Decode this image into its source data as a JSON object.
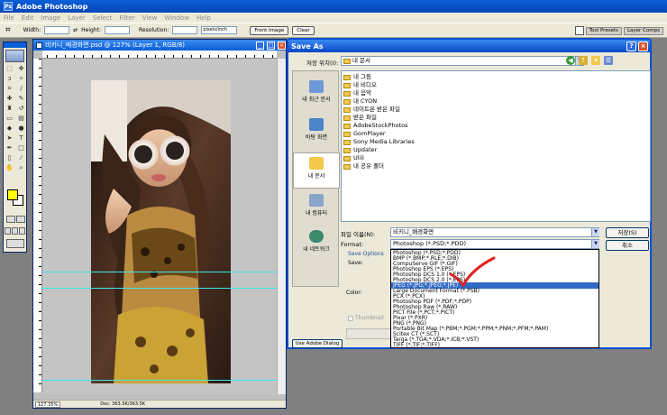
{
  "app": {
    "title": "Adobe Photoshop"
  },
  "menu": [
    "File",
    "Edit",
    "Image",
    "Layer",
    "Select",
    "Filter",
    "View",
    "Window",
    "Help"
  ],
  "options_bar": {
    "width_label": "Width:",
    "height_label": "Height:",
    "resolution_label": "Resolution:",
    "resolution_unit": "pixels/inch",
    "front_image": "Front Image",
    "clear": "Clear",
    "palette_tabs": [
      "Tool Presets",
      "Layer Comps"
    ]
  },
  "document": {
    "title": "비키니_배경화면.psd @ 127% (Layer 1, RGB/8)",
    "zoom": "127.35%",
    "doc_info": "Doc: 363.5K/363.5K"
  },
  "dialog": {
    "title": "Save As",
    "look_in_label": "저장 위치(I):",
    "look_in_value": "내 문서",
    "places": [
      "내 최근 문서",
      "바탕 화면",
      "내 문서",
      "내 컴퓨터",
      "내 네트워크"
    ],
    "files": [
      "내 그림",
      "내 비디오",
      "내 음악",
      "내 CYON",
      "네이트온 받은 파일",
      "받은 파일",
      "AdobeStockPhotos",
      "GomPlayer",
      "Sony Media Libraries",
      "Updater",
      "Ulili",
      "내 공유 폴더"
    ],
    "filename_label": "파일 이름(N):",
    "filename_value": "비키니_배경화면",
    "format_label": "Format:",
    "format_value": "Photoshop (*.PSD;*.PDD)",
    "save_button": "저장(S)",
    "cancel_button": "취소",
    "save_options_label": "Save Options",
    "save_label": "Save:",
    "color_label": "Color:",
    "thumbnail_label": "Thumbnail",
    "use_adobe_dialog": "Use Adobe Dialog",
    "format_options": [
      "Photoshop (*.PSD;*.PDD)",
      "BMP (*.BMP;*.RLE;*.DIB)",
      "CompuServe GIF (*.GIF)",
      "Photoshop EPS (*.EPS)",
      "Photoshop DCS 1.0 (*.EPS)",
      "Photoshop DCS 2.0 (*.EPS)",
      "JPEG (*.JPG;*.JPEG;*.JPE)",
      "Large Document Format (*.PSB)",
      "PCX (*.PCX)",
      "Photoshop PDF (*.PDF;*.PDP)",
      "Photoshop Raw (*.RAW)",
      "PICT File (*.PCT;*.PICT)",
      "Pixar (*.PXR)",
      "PNG (*.PNG)",
      "Portable Bit Map (*.PBM;*.PGM;*.PPM;*.PNM;*.PFM;*.PAM)",
      "Scitex CT (*.SCT)",
      "Targa (*.TGA;*.VDA;*.ICB;*.VST)",
      "TIFF (*.TIF;*.TIFF)"
    ],
    "selected_format_index": 6
  },
  "colors": {
    "titlebar": "#0a5fd8",
    "selection": "#316ac5",
    "guide": "#38e8e8",
    "checkmark": "#e02020",
    "foreground_swatch": "#ffff00"
  }
}
